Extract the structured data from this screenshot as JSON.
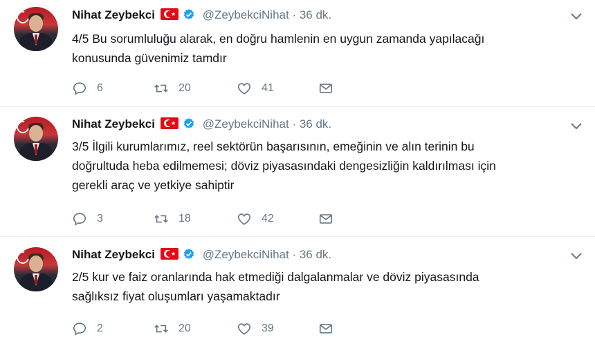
{
  "tweets": [
    {
      "name": "Nihat Zeybekci",
      "handle": "@ZeybekciNihat",
      "dot": "·",
      "time": "36 dk.",
      "lines": [
        "4/5 Bu sorumluluğu alarak, en doğru hamlenin en uygun zamanda yapılacağı",
        "konusunda güvenimiz tamdır"
      ],
      "replies": "6",
      "retweets": "20",
      "likes": "41"
    },
    {
      "name": "Nihat Zeybekci",
      "handle": "@ZeybekciNihat",
      "dot": "·",
      "time": "36 dk.",
      "lines": [
        "3/5 İlgili kurumlarımız, reel sektörün başarısının, emeğinin ve alın terinin bu",
        "doğrultuda heba edilmemesi; döviz piyasasındaki dengesizliğin kaldırılması için",
        "gerekli araç ve yetkiye sahiptir"
      ],
      "replies": "3",
      "retweets": "18",
      "likes": "42"
    },
    {
      "name": "Nihat Zeybekci",
      "handle": "@ZeybekciNihat",
      "dot": "·",
      "time": "36 dk.",
      "lines": [
        "2/5 kur ve faiz oranlarında hak etmediği dalgalanmalar ve döviz piyasasında",
        "sağlıksız fiyat oluşumları yaşamaktadır"
      ],
      "replies": "2",
      "retweets": "20",
      "likes": "39"
    }
  ],
  "icons": {
    "reply": "reply-icon",
    "retweet": "retweet-icon",
    "like": "heart-icon",
    "dm": "envelope-icon",
    "verified": "verified-badge-icon",
    "flag": "turkey-flag-icon",
    "menu": "chevron-down-icon"
  },
  "colors": {
    "accent": "#1da1f2",
    "flag": "#e30a17",
    "muted": "#657786"
  }
}
